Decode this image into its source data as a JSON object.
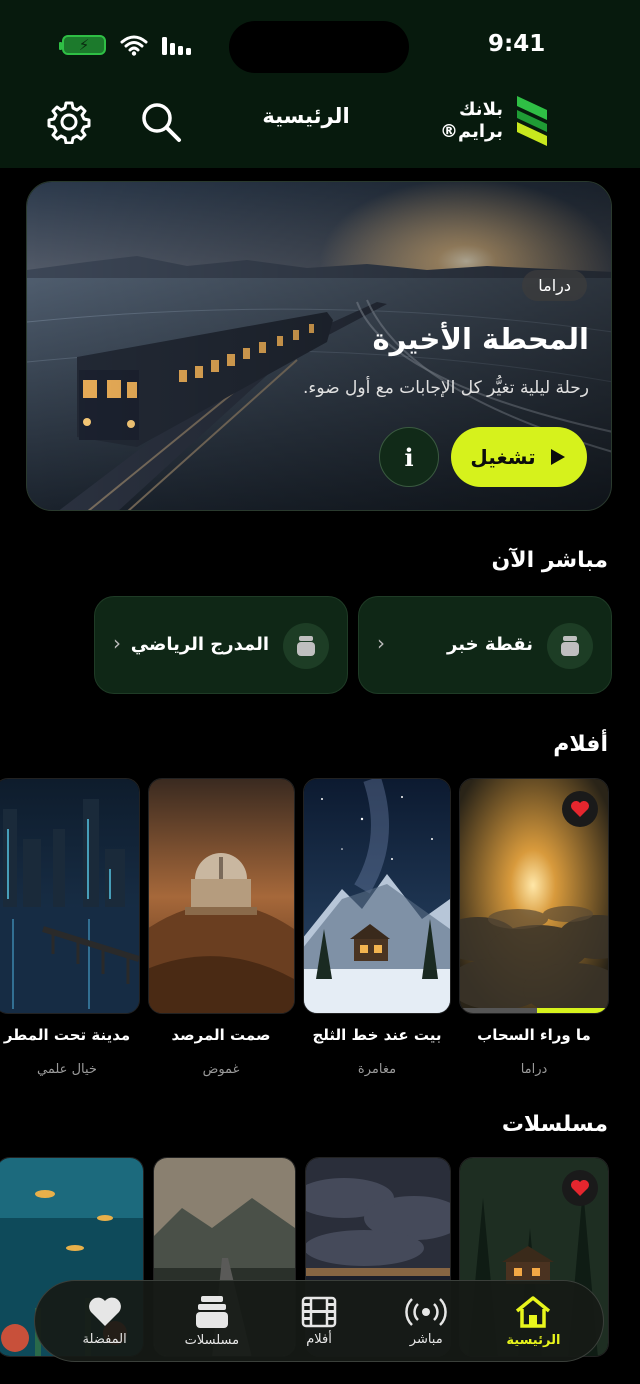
{
  "status_bar": {
    "time": "9:41"
  },
  "header": {
    "brand_line1": "بلانك",
    "brand_line2": "برايم®",
    "title": "الرئيسية",
    "accent": "#d6f21c"
  },
  "hero": {
    "badge": "دراما",
    "title": "المحطة الأخيرة",
    "description": "رحلة ليلية تغيُّر كل الإجابات مع أول ضوء.",
    "play_label": "تشغيل",
    "info_label": "i"
  },
  "live": {
    "title": "مباشر الآن",
    "channels": [
      {
        "label": "نقطة خبر"
      },
      {
        "label": "المدرج الرياضي"
      }
    ]
  },
  "movies": {
    "title": "أفلام",
    "items": [
      {
        "title": "ما وراء السحاب",
        "genre": "دراما",
        "favorite": true,
        "progress": 0.48
      },
      {
        "title": "بيت عند خط الثلج",
        "genre": "مغامرة"
      },
      {
        "title": "صمت المرصد",
        "genre": "غموض"
      },
      {
        "title": "مدينة تحت المطر",
        "genre": "خيال علمي"
      }
    ]
  },
  "series": {
    "title": "مسلسلات",
    "items": [
      {
        "favorite": true
      },
      {},
      {},
      {}
    ]
  },
  "bottom_nav": {
    "items": [
      {
        "label": "الرئيسية",
        "icon": "home-icon",
        "active": true
      },
      {
        "label": "مباشر",
        "icon": "broadcast-icon"
      },
      {
        "label": "أفلام",
        "icon": "film-icon"
      },
      {
        "label": "مسلسلات",
        "icon": "tv-stack-icon"
      },
      {
        "label": "المفضلة",
        "icon": "heart-icon"
      }
    ]
  }
}
